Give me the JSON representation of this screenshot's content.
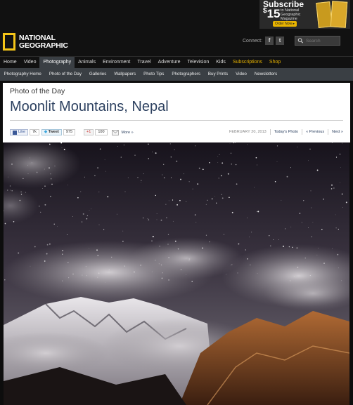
{
  "header": {
    "logo_line1": "NATIONAL",
    "logo_line2": "GEOGRAPHIC",
    "promo": {
      "subscribe": "Subscribe",
      "price": "15",
      "currency": "$",
      "small_text": "to National Geographic Magazine",
      "button": "Order Now ▸"
    },
    "connect_label": "Connect:",
    "social": [
      "f",
      "t"
    ],
    "search_placeholder": "Search"
  },
  "nav_primary": [
    {
      "label": "Home"
    },
    {
      "label": "Video"
    },
    {
      "label": "Photography",
      "active": true
    },
    {
      "label": "Animals"
    },
    {
      "label": "Environment"
    },
    {
      "label": "Travel"
    },
    {
      "label": "Adventure"
    },
    {
      "label": "Television"
    },
    {
      "label": "Kids"
    },
    {
      "label": "Subscriptions",
      "gold": true
    },
    {
      "label": "Shop",
      "gold": true
    }
  ],
  "nav_secondary": [
    {
      "label": "Photography Home"
    },
    {
      "label": "Photo of the Day"
    },
    {
      "label": "Galleries"
    },
    {
      "label": "Wallpapers"
    },
    {
      "label": "Photo Tips"
    },
    {
      "label": "Photographers"
    },
    {
      "label": "Buy Prints"
    },
    {
      "label": "Video"
    },
    {
      "label": "Newsletters"
    }
  ],
  "article": {
    "kicker": "Photo of the Day",
    "title": "Moonlit Mountains, Nepal",
    "share": {
      "like_label": "Like",
      "like_count": "7k",
      "tweet_label": "Tweet",
      "tweet_count": "975",
      "plus_label": "+1",
      "plus_count": "100",
      "more_label": "More »"
    },
    "date": "FEBRUARY 20, 2013",
    "todays_photo": "Today's Photo",
    "previous": "« Previous",
    "next": "Next »"
  },
  "colors": {
    "accent_gold": "#f5c518",
    "title_blue": "#2d4160",
    "nav_active": "#3a3f44"
  }
}
